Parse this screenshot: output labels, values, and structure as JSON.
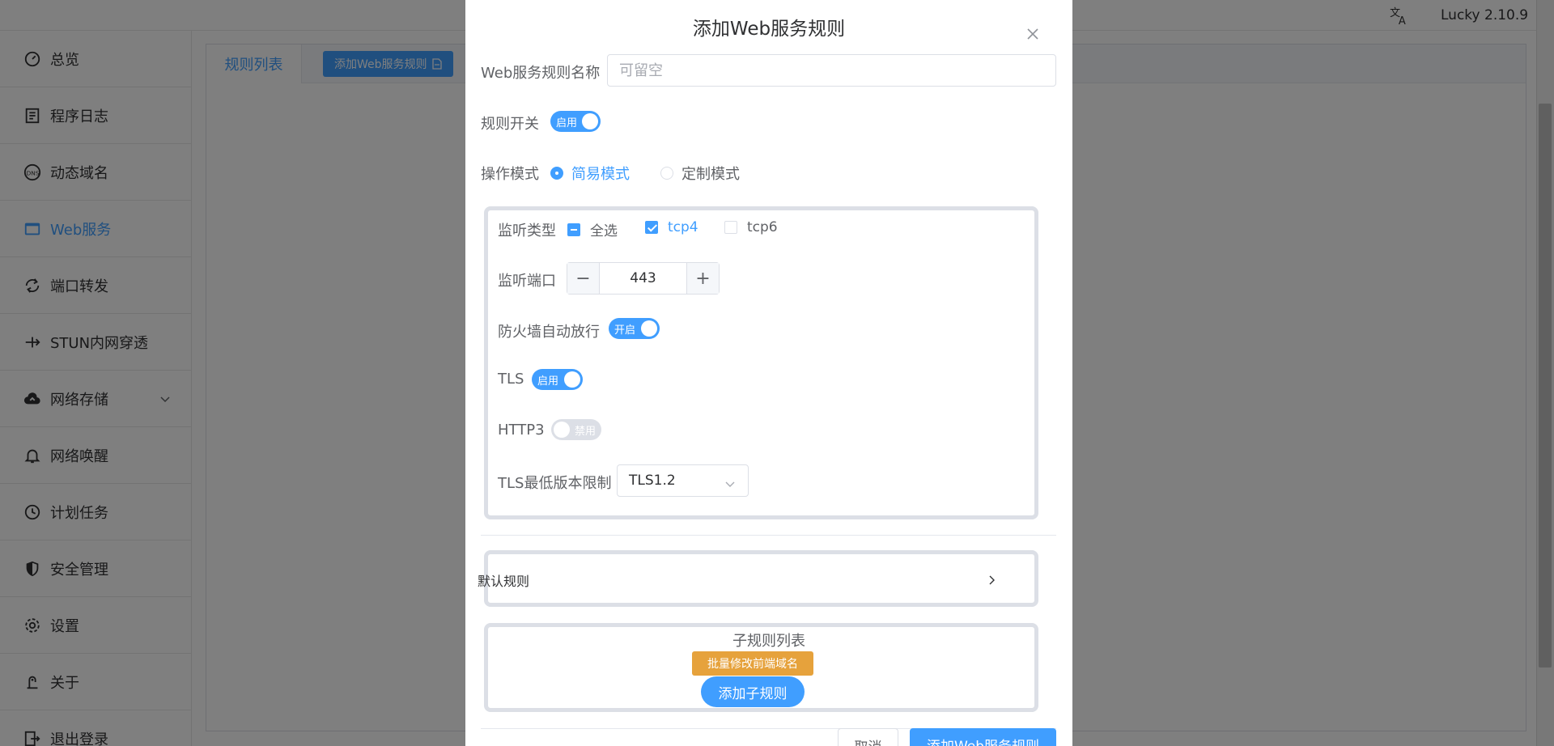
{
  "header": {
    "version": "Lucky 2.10.9",
    "lang_icon": "translate-icon"
  },
  "sidebar": {
    "items": [
      {
        "label": "总览",
        "icon": "dashboard-icon"
      },
      {
        "label": "程序日志",
        "icon": "log-icon"
      },
      {
        "label": "动态域名",
        "icon": "dns-icon"
      },
      {
        "label": "Web服务",
        "icon": "web-icon",
        "active": true
      },
      {
        "label": "端口转发",
        "icon": "port-forward-icon"
      },
      {
        "label": "STUN内网穿透",
        "icon": "stun-icon"
      },
      {
        "label": "网络存储",
        "icon": "cloud-upload-icon",
        "expandable": true
      },
      {
        "label": "网络唤醒",
        "icon": "bell-icon"
      },
      {
        "label": "计划任务",
        "icon": "clock-icon"
      },
      {
        "label": "安全管理",
        "icon": "shield-icon"
      },
      {
        "label": "设置",
        "icon": "gear-icon"
      },
      {
        "label": "关于",
        "icon": "about-icon"
      },
      {
        "label": "退出登录",
        "icon": "logout-icon"
      }
    ]
  },
  "main": {
    "tabs": [
      {
        "label": "规则列表"
      },
      {
        "label": "添加Web服务规则"
      }
    ]
  },
  "dialog": {
    "title": "添加Web服务规则",
    "name_label": "Web服务规则名称",
    "name_placeholder": "可留空",
    "switch_label": "规则开关",
    "switch_text": "启用",
    "mode_label": "操作模式",
    "mode_simple": "简易模式",
    "mode_custom": "定制模式",
    "listen_type_label": "监听类型",
    "listen_all": "全选",
    "listen_tcp4": "tcp4",
    "listen_tcp6": "tcp6",
    "port_label": "监听端口",
    "port_value": "443",
    "firewall_label": "防火墙自动放行",
    "firewall_text": "开启",
    "tls_label": "TLS",
    "tls_text": "启用",
    "http3_label": "HTTP3",
    "http3_text": "禁用",
    "tls_min_label": "TLS最低版本限制",
    "tls_min_value": "TLS1.2",
    "default_rule_label": "默认规则",
    "subrule_title": "子规则列表",
    "batch_button": "批量修改前端域名",
    "add_subrule_button": "添加子规则",
    "cancel_button": "取消",
    "submit_button": "添加Web服务规则"
  },
  "colors": {
    "accent": "#409eff",
    "warning": "#e6a23c"
  }
}
